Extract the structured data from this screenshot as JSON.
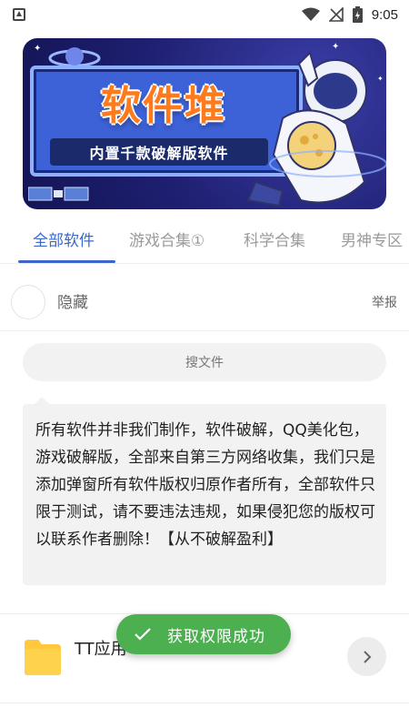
{
  "status_bar": {
    "time": "9:05",
    "icons": [
      "notification-icon",
      "wifi-icon",
      "signal-off-icon",
      "battery-charging-icon"
    ]
  },
  "banner": {
    "title": "软件堆",
    "subtitle": "内置千款破解版软件"
  },
  "tabs": [
    {
      "label": "全部软件",
      "active": true
    },
    {
      "label": "游戏合集①",
      "active": false
    },
    {
      "label": "科学合集",
      "active": false
    },
    {
      "label": "男神专区",
      "active": false
    }
  ],
  "hidden_row": {
    "label": "隐藏",
    "report": "举报"
  },
  "search": {
    "label": "搜文件"
  },
  "notice": {
    "text": "所有软件并非我们制作，软件破解，QQ美化包，游戏破解版，全部来自第三方网络收集，我们只是添加弹窗所有软件版权归原作者所有，全部软件只限于测试，请不要违法违规，如果侵犯您的版权可以联系作者删除！【从不破解盈利】"
  },
  "list": [
    {
      "title": "TT应用",
      "icon": "folder-icon"
    }
  ],
  "toast": {
    "text": "获取权限成功"
  },
  "colors": {
    "accent": "#3a68c9",
    "toast": "#4caf50",
    "folder": "#ffc83d"
  }
}
